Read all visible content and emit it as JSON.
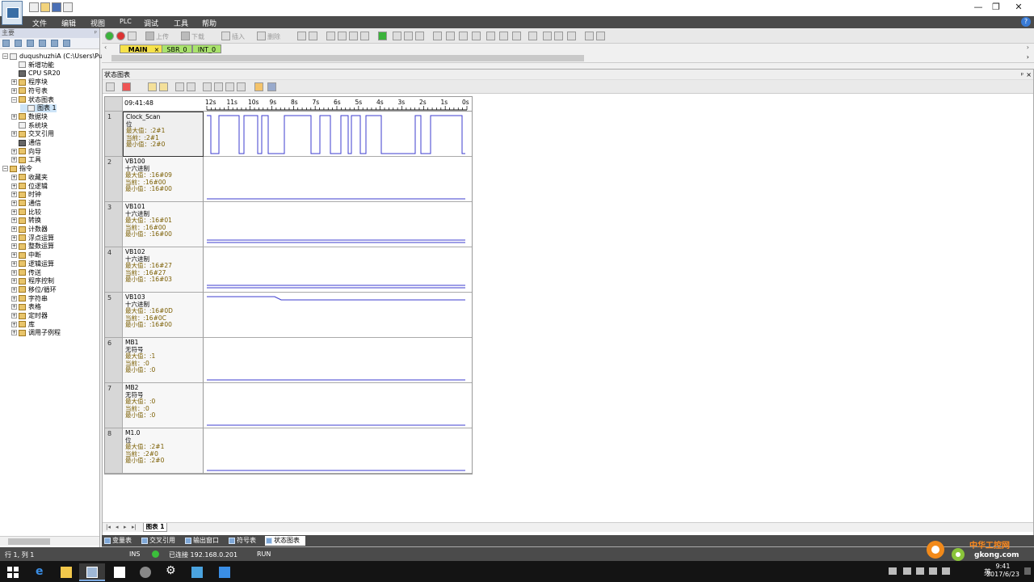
{
  "menu": [
    "文件",
    "编辑",
    "视图",
    "PLC",
    "调试",
    "工具",
    "帮助"
  ],
  "left_panel": {
    "title": "主要",
    "tree": [
      {
        "label": "duqushuzhiA (C:\\Users\\Public",
        "indent": 0,
        "exp": "⊟",
        "icon": "doc"
      },
      {
        "label": "新增功能",
        "indent": 1,
        "exp": "",
        "icon": "doc"
      },
      {
        "label": "CPU SR20",
        "indent": 1,
        "exp": "",
        "icon": "chip"
      },
      {
        "label": "程序块",
        "indent": 1,
        "exp": "⊞",
        "icon": "folder"
      },
      {
        "label": "符号表",
        "indent": 1,
        "exp": "⊞",
        "icon": "folder"
      },
      {
        "label": "状态图表",
        "indent": 1,
        "exp": "⊟",
        "icon": "folder"
      },
      {
        "label": "图表 1",
        "indent": 2,
        "exp": "",
        "icon": "doc",
        "selected": true
      },
      {
        "label": "数据块",
        "indent": 1,
        "exp": "⊞",
        "icon": "folder"
      },
      {
        "label": "系统块",
        "indent": 1,
        "exp": "",
        "icon": "doc"
      },
      {
        "label": "交叉引用",
        "indent": 1,
        "exp": "⊞",
        "icon": "folder"
      },
      {
        "label": "通信",
        "indent": 1,
        "exp": "",
        "icon": "chip"
      },
      {
        "label": "向导",
        "indent": 1,
        "exp": "⊞",
        "icon": "folder"
      },
      {
        "label": "工具",
        "indent": 1,
        "exp": "⊞",
        "icon": "folder"
      },
      {
        "label": "指令",
        "indent": 0,
        "exp": "⊟",
        "icon": "folder"
      },
      {
        "label": "收藏夹",
        "indent": 1,
        "exp": "⊞",
        "icon": "folder"
      },
      {
        "label": "位逻辑",
        "indent": 1,
        "exp": "⊞",
        "icon": "folder"
      },
      {
        "label": "时钟",
        "indent": 1,
        "exp": "⊞",
        "icon": "folder"
      },
      {
        "label": "通信",
        "indent": 1,
        "exp": "⊞",
        "icon": "folder"
      },
      {
        "label": "比较",
        "indent": 1,
        "exp": "⊞",
        "icon": "folder"
      },
      {
        "label": "转换",
        "indent": 1,
        "exp": "⊞",
        "icon": "folder"
      },
      {
        "label": "计数器",
        "indent": 1,
        "exp": "⊞",
        "icon": "folder"
      },
      {
        "label": "浮点运算",
        "indent": 1,
        "exp": "⊞",
        "icon": "folder"
      },
      {
        "label": "整数运算",
        "indent": 1,
        "exp": "⊞",
        "icon": "folder"
      },
      {
        "label": "中断",
        "indent": 1,
        "exp": "⊞",
        "icon": "folder"
      },
      {
        "label": "逻辑运算",
        "indent": 1,
        "exp": "⊞",
        "icon": "folder"
      },
      {
        "label": "传送",
        "indent": 1,
        "exp": "⊞",
        "icon": "folder"
      },
      {
        "label": "程序控制",
        "indent": 1,
        "exp": "⊞",
        "icon": "folder"
      },
      {
        "label": "移位/循环",
        "indent": 1,
        "exp": "⊞",
        "icon": "folder"
      },
      {
        "label": "字符串",
        "indent": 1,
        "exp": "⊞",
        "icon": "folder"
      },
      {
        "label": "表格",
        "indent": 1,
        "exp": "⊞",
        "icon": "folder"
      },
      {
        "label": "定时器",
        "indent": 1,
        "exp": "⊞",
        "icon": "folder"
      },
      {
        "label": "库",
        "indent": 1,
        "exp": "⊞",
        "icon": "folder"
      },
      {
        "label": "调用子例程",
        "indent": 1,
        "exp": "⊞",
        "icon": "folder"
      }
    ]
  },
  "toolbar": {
    "upload": "上传",
    "download": "下载",
    "insert": "插入",
    "delete": "删除"
  },
  "program_tabs": [
    "MAIN",
    "SBR_0",
    "INT_0"
  ],
  "chart_window": {
    "title": "状态图表",
    "time": "09:41:48",
    "ticks": [
      "12s",
      "11s",
      "10s",
      "9s",
      "8s",
      "7s",
      "6s",
      "5s",
      "4s",
      "3s",
      "2s",
      "1s",
      "0s"
    ],
    "rows": [
      {
        "num": "1",
        "name": "Clock_Scan",
        "type": "位",
        "max": "最大值：:2#1",
        "cur": "当前：:2#1",
        "min": "最小值：:2#0"
      },
      {
        "num": "2",
        "name": "VB100",
        "type": "十六进制",
        "max": "最大值：:16#09",
        "cur": "当前：:16#00",
        "min": "最小值：:16#00"
      },
      {
        "num": "3",
        "name": "VB101",
        "type": "十六进制",
        "max": "最大值：:16#01",
        "cur": "当前：:16#00",
        "min": "最小值：:16#00"
      },
      {
        "num": "4",
        "name": "VB102",
        "type": "十六进制",
        "max": "最大值：:16#27",
        "cur": "当前：:16#27",
        "min": "最小值：:16#03"
      },
      {
        "num": "5",
        "name": "VB103",
        "type": "十六进制",
        "max": "最大值：:16#0D",
        "cur": "当前：:16#0C",
        "min": "最小值：:16#00"
      },
      {
        "num": "6",
        "name": "MB1",
        "type": "无符号",
        "max": "最大值：:1",
        "cur": "当前：:0",
        "min": "最小值：:0"
      },
      {
        "num": "7",
        "name": "MB2",
        "type": "无符号",
        "max": "最大值：:0",
        "cur": "当前：:0",
        "min": "最小值：:0"
      },
      {
        "num": "8",
        "name": "M1.0",
        "type": "位",
        "max": "最大值：:2#1",
        "cur": "当前：:2#0",
        "min": "最小值：:2#0"
      }
    ],
    "page_tab": "图表 1"
  },
  "bottom_tabs": [
    "变量表",
    "交叉引用",
    "输出窗口",
    "符号表",
    "状态图表"
  ],
  "status": {
    "pos": "行 1, 列 1",
    "mode": "INS",
    "connection": "已连接 192.168.0.201",
    "state": "RUN"
  },
  "tray": {
    "lang": "英",
    "time": "9:41",
    "date": "2017/6/23"
  },
  "watermark": {
    "text": "中华工控网",
    "url": "gkong.com"
  }
}
